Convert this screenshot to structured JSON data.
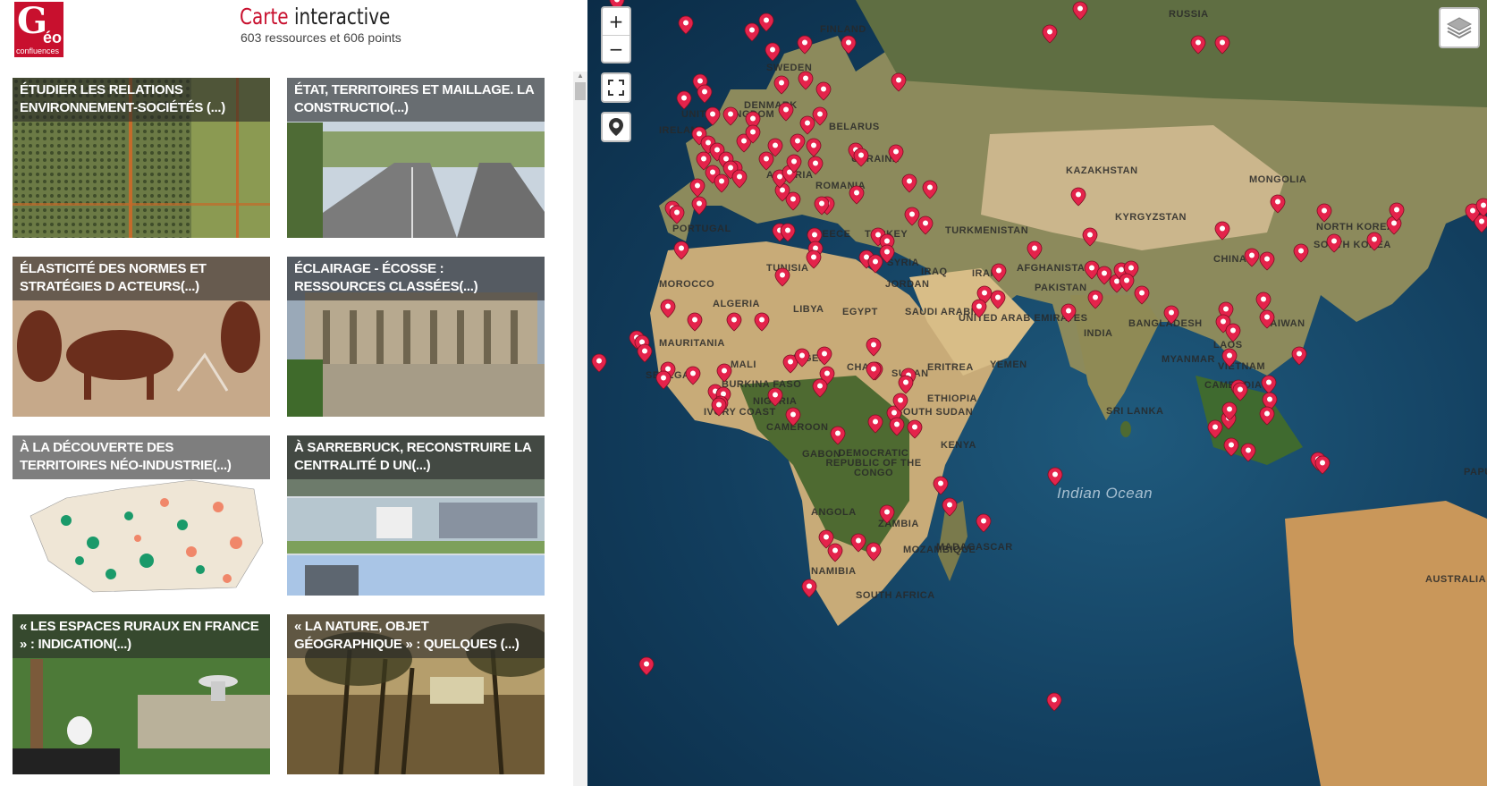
{
  "header": {
    "logo": {
      "letter": "G",
      "suffix": "éo",
      "brand": "confluences"
    },
    "title_word1": "Carte",
    "title_word2": "interactive",
    "subtitle": "603 ressources et 606 points"
  },
  "cards": [
    {
      "title": "ÉTUDIER LES RELATIONS ENVIRONNEMENT-SOCIÉTÉS (...)",
      "image": "aerial-fields"
    },
    {
      "title": "ÉTAT, TERRITOIRES ET MAILLAGE. LA CONSTRUCTIO(...)",
      "image": "highway"
    },
    {
      "title": "ÉLASTICITÉ DES NORMES ET STRATÉGIES D ACTEURS(...)",
      "image": "rock-art"
    },
    {
      "title": "ÉCLAIRAGE - ÉCOSSE : RESSOURCES CLASSÉES(...)",
      "image": "museum-scotland"
    },
    {
      "title": "À LA DÉCOUVERTE DES TERRITOIRES NÉO-INDUSTRIE(...)",
      "image": "map-france"
    },
    {
      "title": "À SARREBRUCK, RECONSTRUIRE LA CENTRALITÉ D UN(...)",
      "image": "city-buildings"
    },
    {
      "title": "« LES ESPACES RURAUX EN FRANCE » : INDICATION(...)",
      "image": "rural-garden"
    },
    {
      "title": "« LA NATURE, OBJET GÉOGRAPHIQUE » : QUELQUES (...)",
      "image": "painting-trees"
    }
  ],
  "map": {
    "controls": {
      "zoom_in": "+",
      "zoom_out": "−",
      "fullscreen_icon": "fullscreen-icon",
      "locate_icon": "locate-icon",
      "layers_icon": "layers-icon"
    },
    "labels": [
      "RUSSIA",
      "FINLAND",
      "SWEDEN",
      "DENMARK",
      "UNITED KINGDOM",
      "IRELAND",
      "BELARUS",
      "UKRAINE",
      "ROMANIA",
      "AUSTRIA",
      "PORTUGAL",
      "GREECE",
      "TURKEY",
      "KAZAKHSTAN",
      "MONGOLIA",
      "KYRGYZSTAN",
      "TURKMENISTAN",
      "SYRIA",
      "IRAQ",
      "IRAN",
      "AFGHANISTAN",
      "PAKISTAN",
      "JORDAN",
      "TUNISIA",
      "MOROCCO",
      "ALGERIA",
      "LIBYA",
      "EGYPT",
      "SAUDI ARABIA",
      "UNITED ARAB EMIRATES",
      "INDIA",
      "BANGLADESH",
      "CHINA",
      "NORTH KOREA",
      "SOUTH KOREA",
      "TAIWAN",
      "MYANMAR",
      "LAOS",
      "VIETNAM",
      "CAMBODIA",
      "SRI LANKA",
      "MAURITANIA",
      "MALI",
      "NIGER",
      "SENEGAL",
      "BURKINA FASO",
      "IVORY COAST",
      "NIGERIA",
      "CHAD",
      "SUDAN",
      "ERITREA",
      "YEMEN",
      "ETHIOPIA",
      "SOUTH SUDAN",
      "CAMEROON",
      "GABON",
      "DEMOCRATIC REPUBLIC OF THE CONGO",
      "KENYA",
      "ANGOLA",
      "ZAMBIA",
      "MOZAMBIQUE",
      "MADAGASCAR",
      "NAMIBIA",
      "SOUTH AFRICA",
      "Indian Ocean",
      "AUSTRALIA",
      "PAPUA"
    ],
    "marker_color": "#e4234b"
  }
}
